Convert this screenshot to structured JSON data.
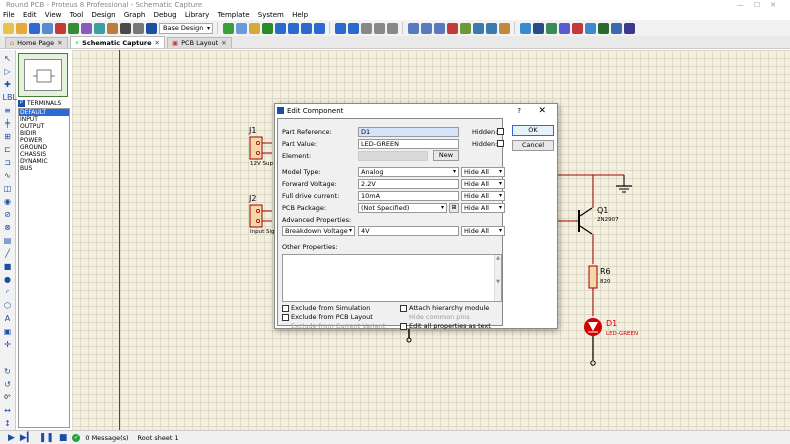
{
  "window": {
    "title": "Round PCB - Proteus 8 Professional - Schematic Capture"
  },
  "menu": [
    "File",
    "Edit",
    "View",
    "Tool",
    "Design",
    "Graph",
    "Debug",
    "Library",
    "Template",
    "System",
    "Help"
  ],
  "toolbar": {
    "design_dropdown": "Base Design"
  },
  "tabs": [
    {
      "label": "Home Page",
      "active": false
    },
    {
      "label": "Schematic Capture",
      "active": true
    },
    {
      "label": "PCB Layout",
      "active": false
    }
  ],
  "panel": {
    "mode_letter": "P",
    "title": "TERMINALS",
    "items": [
      "DEFAULT",
      "INPUT",
      "OUTPUT",
      "BIDIR",
      "POWER",
      "GROUND",
      "CHASSIS",
      "DYNAMIC",
      "BUS"
    ],
    "selected_index": 0
  },
  "schematic": {
    "j1": {
      "ref": "J1",
      "label": "12V Sup"
    },
    "j2": {
      "ref": "J2",
      "label": "Input Sig"
    },
    "q1": {
      "ref": "Q1",
      "value": "2N2907"
    },
    "r6": {
      "ref": "R6",
      "value": "820"
    },
    "d1": {
      "ref": "D1",
      "value": "LED-GREEN"
    }
  },
  "dialog": {
    "title": "Edit Component",
    "help": "?",
    "close": "✕",
    "part_reference_label": "Part Reference:",
    "part_reference_value": "D1",
    "part_value_label": "Part Value:",
    "part_value_value": "LED-GREEN",
    "element_label": "Element:",
    "hidden_label": "Hidden:",
    "new_button": "New",
    "model_type_label": "Model Type:",
    "model_type_value": "Analog",
    "forward_voltage_label": "Forward Voltage:",
    "forward_voltage_value": "2.2V",
    "full_drive_label": "Full drive current:",
    "full_drive_value": "10mA",
    "pcb_package_label": "PCB Package:",
    "pcb_package_value": "(Not Specified)",
    "advanced_label": "Advanced Properties:",
    "advanced_select": "Breakdown Voltage",
    "advanced_value": "4V",
    "hide_all": "Hide All",
    "other_label": "Other Properties:",
    "ok_button": "OK",
    "cancel_button": "Cancel",
    "checks": {
      "exclude_sim": "Exclude from Simulation",
      "exclude_pcb": "Exclude from PCB Layout",
      "exclude_variant": "Exclude from Current Variant",
      "attach_hier": "Attach hierarchy module",
      "hide_pins": "Hide common pins",
      "edit_all": "Edit all properties as text"
    }
  },
  "status": {
    "messages": "0 Message(s)",
    "sheet": "Root sheet 1"
  },
  "rotation_readout": "0°",
  "colors": {
    "accent": "#2e6ad6",
    "led": "#d40000",
    "wire": "#a00000",
    "blue_line": "#2c40d8"
  }
}
